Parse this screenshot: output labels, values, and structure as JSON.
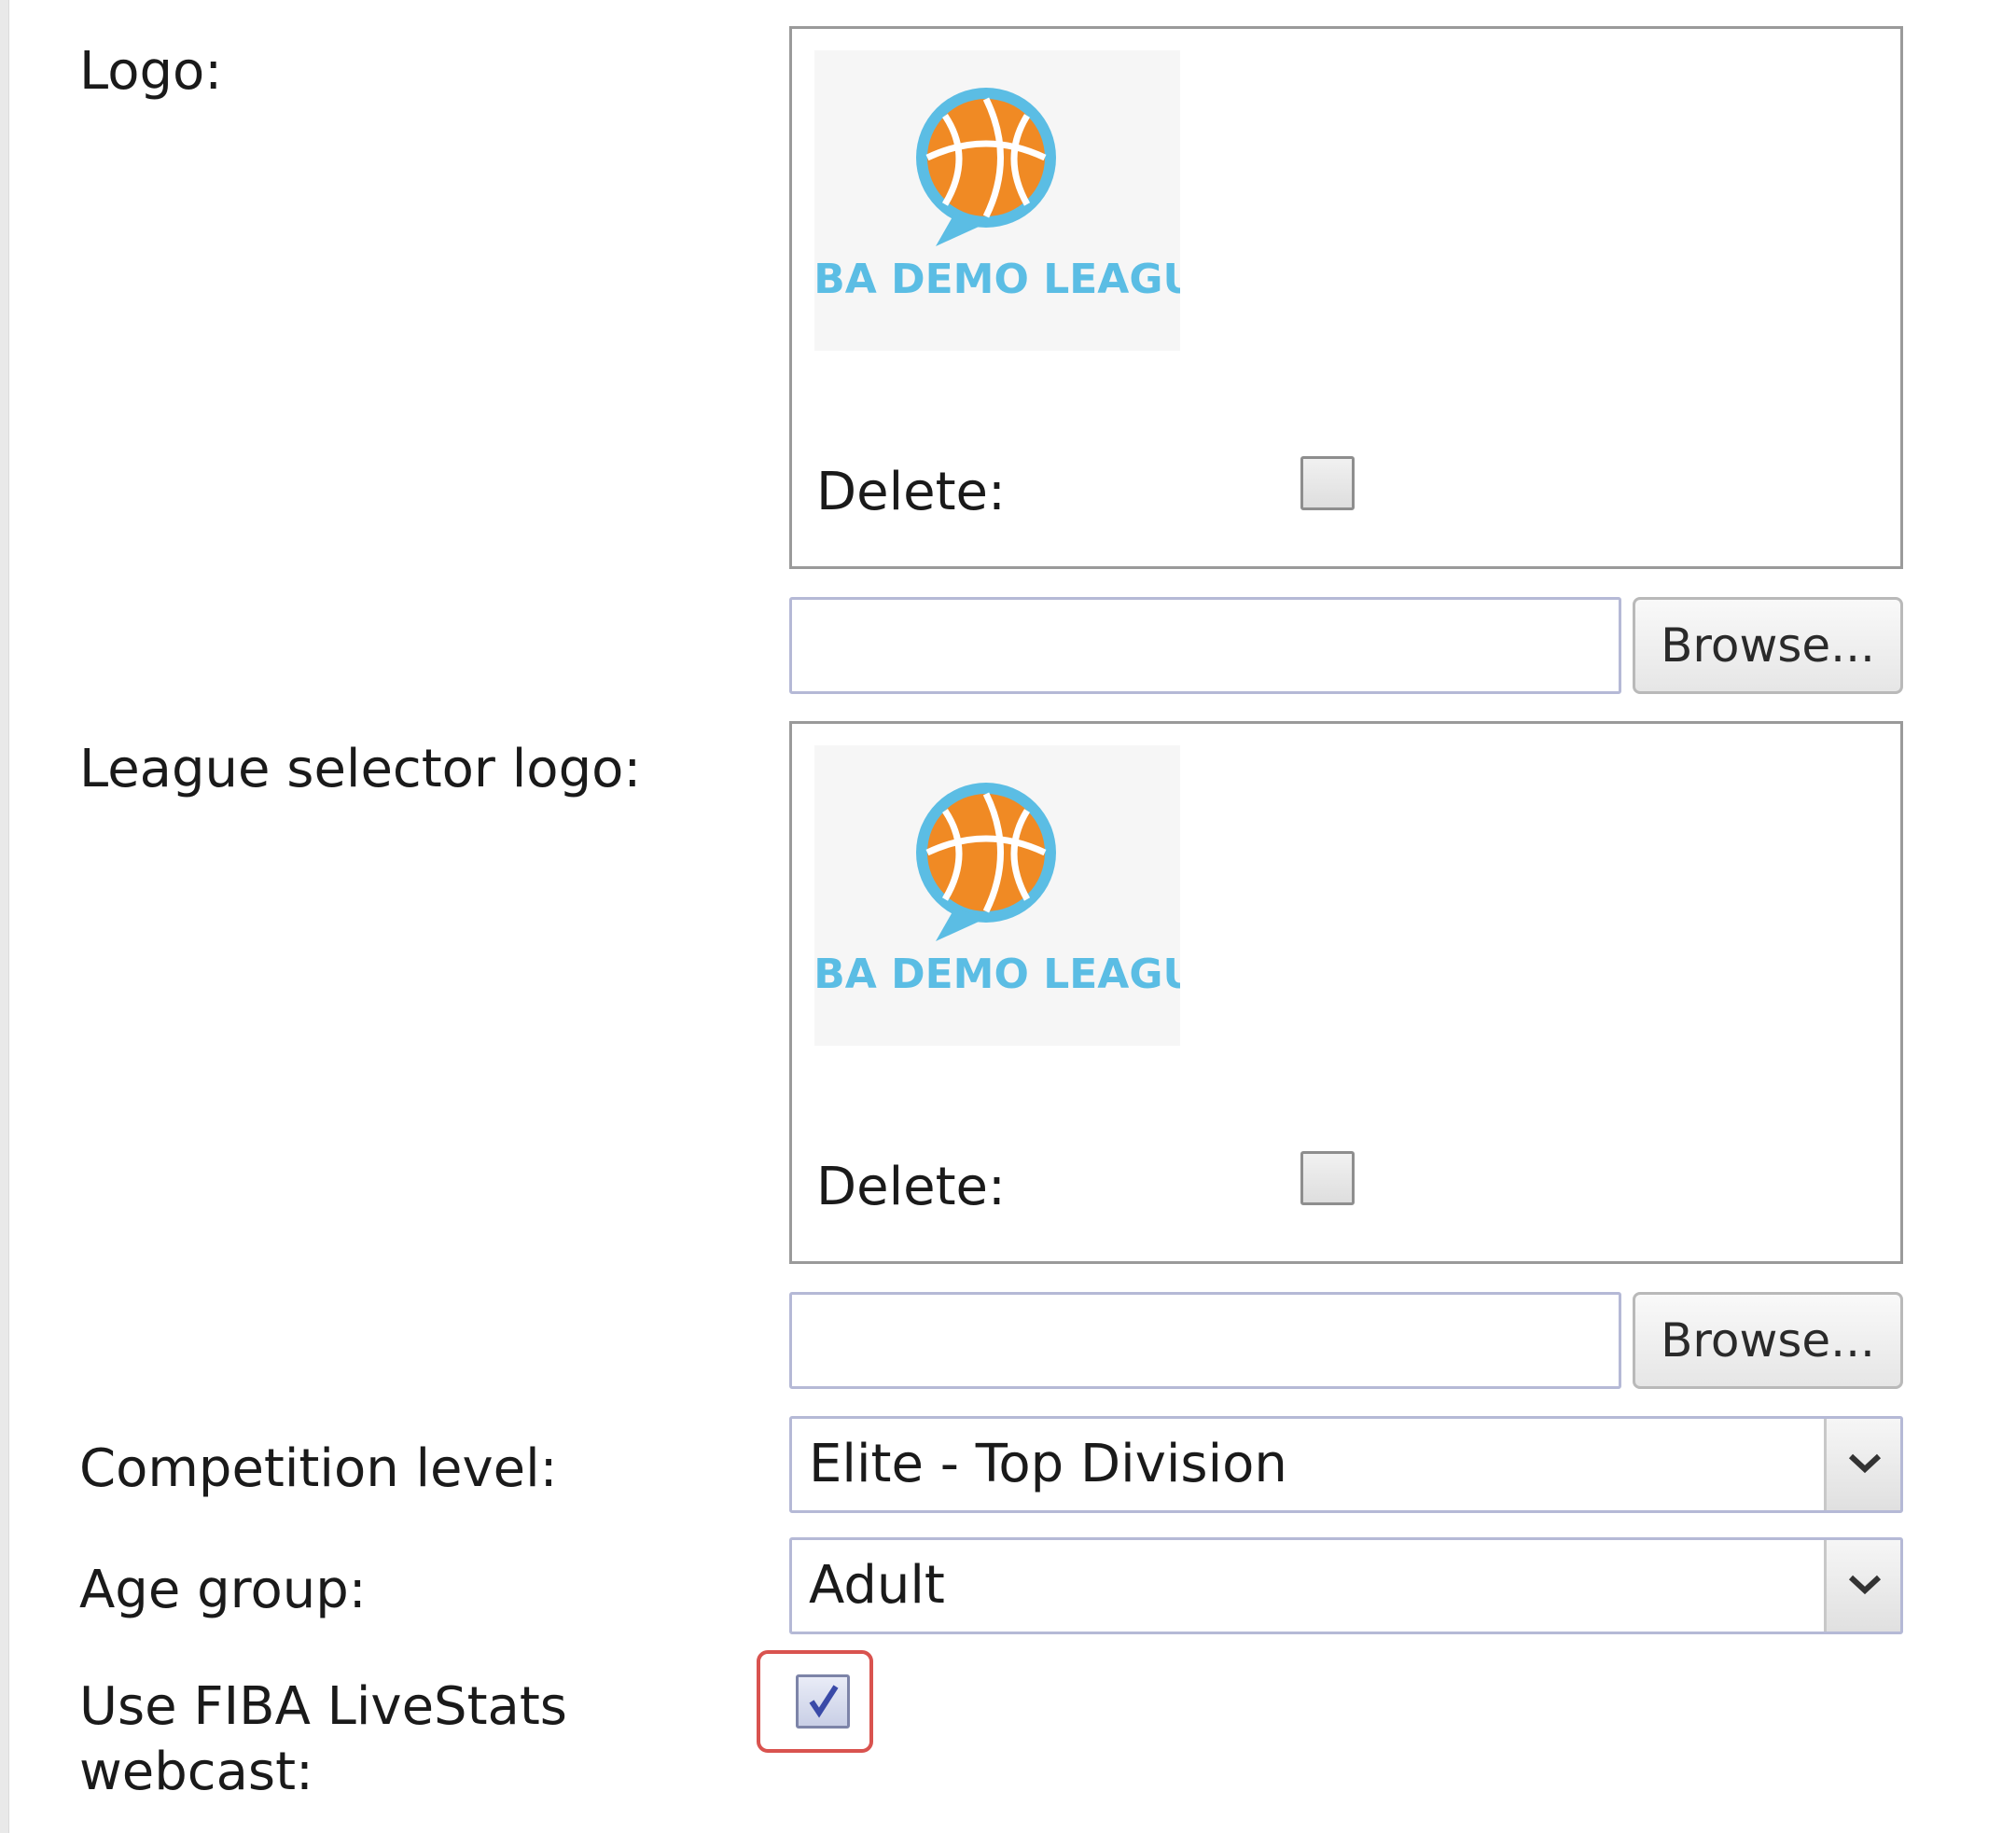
{
  "form": {
    "logo": {
      "label": "Logo:",
      "image_alt": "FIBA DEMO LEAGUE",
      "delete_label": "Delete:",
      "delete_checked": false,
      "browse_label": "Browse...",
      "file_value": ""
    },
    "league_selector_logo": {
      "label": "League selector logo:",
      "image_alt": "FIBA DEMO LEAGUE",
      "delete_label": "Delete:",
      "delete_checked": false,
      "browse_label": "Browse...",
      "file_value": ""
    },
    "competition_level": {
      "label": "Competition level:",
      "value": "Elite - Top Division"
    },
    "age_group": {
      "label": "Age group:",
      "value": "Adult"
    },
    "livestats_webcast": {
      "label": "Use FIBA LiveStats webcast:",
      "checked": true
    }
  },
  "colors": {
    "ball_orange": "#f08a24",
    "logo_blue": "#5bbde4",
    "highlight_red": "#d9534f"
  },
  "icons": {
    "logo": "basketball-chat-bubble-icon",
    "select_arrow": "chevron-down-icon",
    "check": "checkmark-icon"
  }
}
